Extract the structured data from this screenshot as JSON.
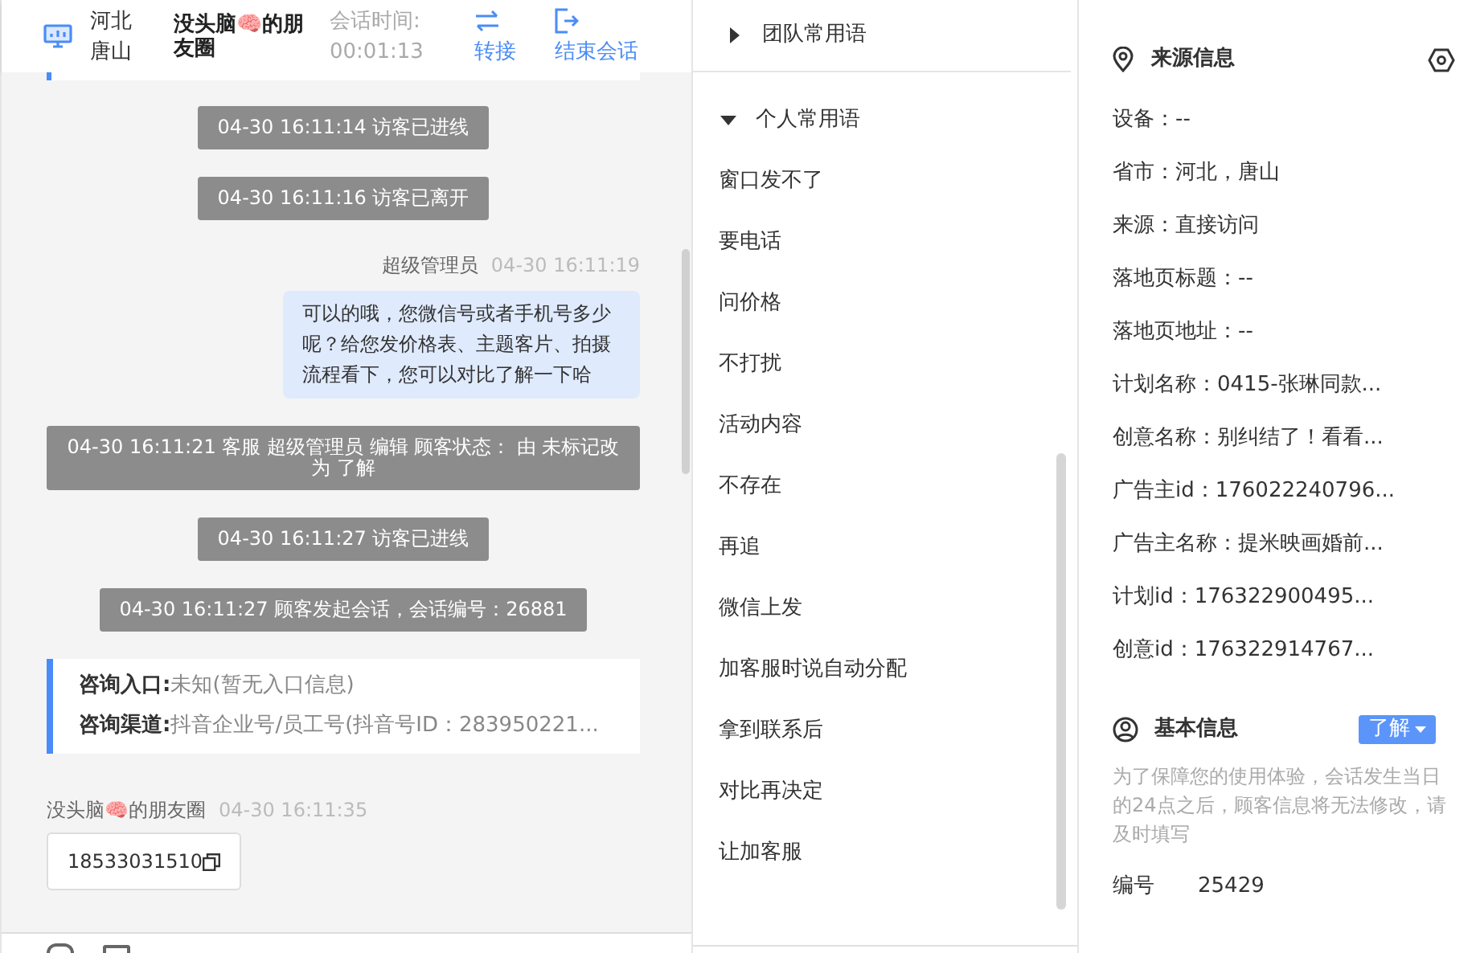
{
  "header": {
    "location_lines": [
      "河北",
      "唐山"
    ],
    "visitor_name": "没头脑🧠的朋友圈",
    "session_time_label": "会话时间:",
    "session_time": "00:01:13",
    "actions": [
      {
        "kind": "transfer",
        "label": "转接"
      },
      {
        "kind": "end",
        "label": "结束会话"
      }
    ]
  },
  "messages": [
    {
      "kind": "system",
      "text": "04-30 16:11:14 访客已进线"
    },
    {
      "kind": "system",
      "text": "04-30 16:11:16 访客已离开"
    },
    {
      "kind": "agent",
      "sender": "超级管理员",
      "time": "04-30 16:11:19",
      "text": "可以的哦，您微信号或者手机号多少呢？给您发价格表、主题客片、拍摄流程看下，您可以对比了解一下哈"
    },
    {
      "kind": "system",
      "text": "04-30 16:11:21 客服 超级管理员 编辑 顾客状态： 由 未标记改为 了解"
    },
    {
      "kind": "system",
      "text": "04-30 16:11:27 访客已进线"
    },
    {
      "kind": "system",
      "text": "04-30 16:11:27 顾客发起会话，会话编号：26881"
    },
    {
      "kind": "entry",
      "rows": [
        {
          "label": "咨询入口:",
          "value": "未知(暂无入口信息)"
        },
        {
          "label": "咨询渠道:",
          "value": "抖音企业号/员工号(抖音号ID：283950221..."
        }
      ]
    },
    {
      "kind": "visitor",
      "sender": "没头脑🧠的朋友圈",
      "time": "04-30 16:11:35",
      "text": "18533031510"
    }
  ],
  "phrases": {
    "groups": [
      {
        "label": "团队常用语",
        "expanded": false
      },
      {
        "label": "个人常用语",
        "expanded": true
      }
    ],
    "items": [
      "窗口发不了",
      "要电话",
      "问价格",
      "不打扰",
      "活动内容",
      "不存在",
      "再追",
      "微信上发",
      "加客服时说自动分配",
      "拿到联系后",
      "对比再决定",
      "让加客服"
    ]
  },
  "source_info": {
    "title": "来源信息",
    "rows": [
      "设备：--",
      "省市：河北，唐山",
      "来源：直接访问",
      "落地页标题：--",
      "落地页地址：--",
      "计划名称：0415-张琳同款...",
      "创意名称：别纠结了！看看...",
      "广告主id：176022240796...",
      "广告主名称：提米映画婚前...",
      "计划id：176322900495...",
      "创意id：176322914767..."
    ]
  },
  "basic_info": {
    "title": "基本信息",
    "status": "了解",
    "note": "为了保障您的使用体验，会话发生当日的24点之后，顾客信息将无法修改，请及时填写",
    "fields": [
      {
        "label": "编号",
        "value": "25429"
      }
    ]
  }
}
